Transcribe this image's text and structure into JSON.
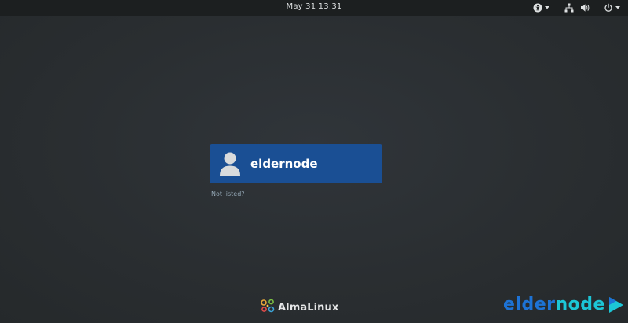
{
  "topbar": {
    "datetime": "May 31  13:31",
    "icons": [
      "accessibility-icon",
      "chevron-down-icon",
      "network-icon",
      "volume-icon",
      "power-icon",
      "chevron-down-icon"
    ]
  },
  "login": {
    "user": {
      "name": "eldernode",
      "avatar_icon": "user-avatar-icon"
    },
    "not_listed_label": "Not listed?"
  },
  "branding": {
    "distro_name": "AlmaLinux",
    "distro_icon": "almalinux-logo-icon"
  },
  "watermark": {
    "part1": "elder",
    "part2": "node",
    "icon": "play-logo-icon"
  },
  "colors": {
    "background": "#2b2f31",
    "topbar": "#1c1f20",
    "user_card": "#1a4f94",
    "link": "#93a6b4",
    "watermark_elder": "#1d73d6",
    "watermark_node": "#1cc6d6"
  }
}
